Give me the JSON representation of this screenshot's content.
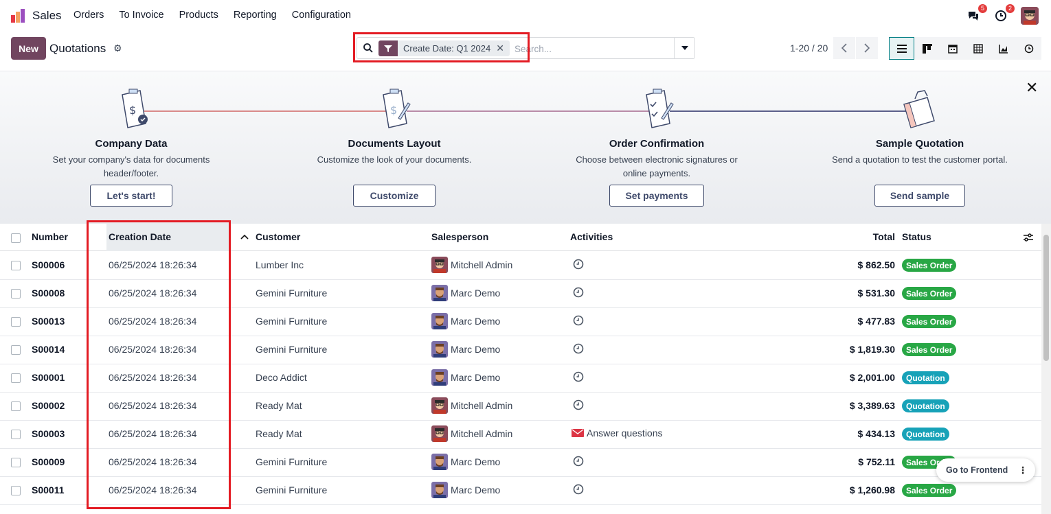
{
  "app": {
    "name": "Sales"
  },
  "menu": [
    "Orders",
    "To Invoice",
    "Products",
    "Reporting",
    "Configuration"
  ],
  "nav": {
    "messages_count": "5",
    "activities_count": "2"
  },
  "control": {
    "new_label": "New",
    "title": "Quotations",
    "facet_label": "Create Date: Q1 2024",
    "search_placeholder": "Search...",
    "pager": "1-20 / 20"
  },
  "onboarding": {
    "steps": [
      {
        "title": "Company Data",
        "desc": "Set your company's data for documents header/footer.",
        "button": "Let's start!"
      },
      {
        "title": "Documents Layout",
        "desc": "Customize the look of your documents.",
        "button": "Customize"
      },
      {
        "title": "Order Confirmation",
        "desc": "Choose between electronic signatures or online payments.",
        "button": "Set payments"
      },
      {
        "title": "Sample Quotation",
        "desc": "Send a quotation to test the customer portal.",
        "button": "Send sample"
      }
    ]
  },
  "table": {
    "headers": {
      "number": "Number",
      "creation_date": "Creation Date",
      "customer": "Customer",
      "salesperson": "Salesperson",
      "activities": "Activities",
      "total": "Total",
      "status": "Status"
    },
    "rows": [
      {
        "number": "S00006",
        "date": "06/25/2024 18:26:34",
        "customer": "Lumber Inc",
        "salesperson": "Mitchell Admin",
        "activity": "",
        "total": "$ 862.50",
        "status": "Sales Order"
      },
      {
        "number": "S00008",
        "date": "06/25/2024 18:26:34",
        "customer": "Gemini Furniture",
        "salesperson": "Marc Demo",
        "activity": "",
        "total": "$ 531.30",
        "status": "Sales Order"
      },
      {
        "number": "S00013",
        "date": "06/25/2024 18:26:34",
        "customer": "Gemini Furniture",
        "salesperson": "Marc Demo",
        "activity": "",
        "total": "$ 477.83",
        "status": "Sales Order"
      },
      {
        "number": "S00014",
        "date": "06/25/2024 18:26:34",
        "customer": "Gemini Furniture",
        "salesperson": "Marc Demo",
        "activity": "",
        "total": "$ 1,819.30",
        "status": "Sales Order"
      },
      {
        "number": "S00001",
        "date": "06/25/2024 18:26:34",
        "customer": "Deco Addict",
        "salesperson": "Marc Demo",
        "activity": "",
        "total": "$ 2,001.00",
        "status": "Quotation"
      },
      {
        "number": "S00002",
        "date": "06/25/2024 18:26:34",
        "customer": "Ready Mat",
        "salesperson": "Mitchell Admin",
        "activity": "",
        "total": "$ 3,389.63",
        "status": "Quotation"
      },
      {
        "number": "S00003",
        "date": "06/25/2024 18:26:34",
        "customer": "Ready Mat",
        "salesperson": "Mitchell Admin",
        "activity": "Answer questions",
        "total": "$ 434.13",
        "status": "Quotation"
      },
      {
        "number": "S00009",
        "date": "06/25/2024 18:26:34",
        "customer": "Gemini Furniture",
        "salesperson": "Marc Demo",
        "activity": "",
        "total": "$ 752.11",
        "status": "Sales Order"
      },
      {
        "number": "S00011",
        "date": "06/25/2024 18:26:34",
        "customer": "Gemini Furniture",
        "salesperson": "Marc Demo",
        "activity": "",
        "total": "$ 1,260.98",
        "status": "Sales Order"
      }
    ]
  },
  "floating": {
    "goto_label": "Go to Frontend"
  },
  "colors": {
    "brand": "#71455f",
    "sales_order": "#28a745",
    "quotation": "#17a2b8",
    "highlight": "#e31b23",
    "accent": "#017e84"
  }
}
